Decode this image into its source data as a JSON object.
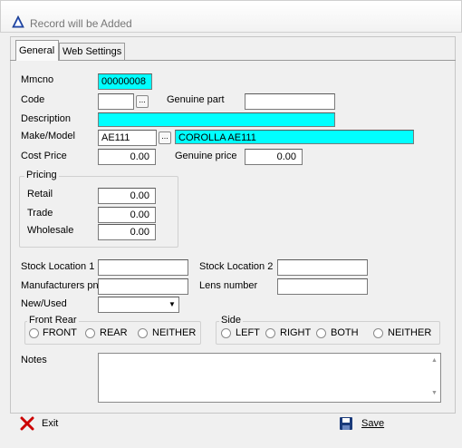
{
  "window": {
    "title": "Record will be Added"
  },
  "tabs": [
    {
      "label": "General"
    },
    {
      "label": "Web Settings"
    }
  ],
  "fields": {
    "mmcno": {
      "label": "Mmcno",
      "value": "00000008"
    },
    "code": {
      "label": "Code",
      "value": ""
    },
    "genuine_part": {
      "label": "Genuine part",
      "value": ""
    },
    "description": {
      "label": "Description",
      "value": ""
    },
    "make_model": {
      "label": "Make/Model",
      "make": "AE111",
      "model": "COROLLA AE111"
    },
    "cost_price": {
      "label": "Cost Price",
      "value": "0.00"
    },
    "genuine_price": {
      "label": "Genuine price",
      "value": "0.00"
    },
    "stock_location_1": {
      "label": "Stock Location 1",
      "value": ""
    },
    "stock_location_2": {
      "label": "Stock Location 2",
      "value": ""
    },
    "manufacturers_pn": {
      "label": "Manufacturers pn",
      "value": ""
    },
    "lens_number": {
      "label": "Lens number",
      "value": ""
    },
    "new_used": {
      "label": "New/Used",
      "value": ""
    },
    "notes": {
      "label": "Notes",
      "value": ""
    }
  },
  "pricing": {
    "caption": "Pricing",
    "retail": {
      "label": "Retail",
      "value": "0.00"
    },
    "trade": {
      "label": "Trade",
      "value": "0.00"
    },
    "wholesale": {
      "label": "Wholesale",
      "value": "0.00"
    }
  },
  "front_rear": {
    "caption": "Front Rear",
    "options": [
      "FRONT",
      "REAR",
      "NEITHER"
    ]
  },
  "side": {
    "caption": "Side",
    "options": [
      "LEFT",
      "RIGHT",
      "BOTH",
      "NEITHER"
    ]
  },
  "buttons": {
    "exit": "Exit",
    "save": "Save"
  },
  "ellipsis": "...",
  "colors": {
    "highlight": "#00ffff",
    "exit_icon": "#cc0000",
    "save_icon": "#1a3a7a"
  },
  "icons": {
    "title": "warning-triangle-icon",
    "exit": "red-x-icon",
    "save": "floppy-disk-icon"
  }
}
